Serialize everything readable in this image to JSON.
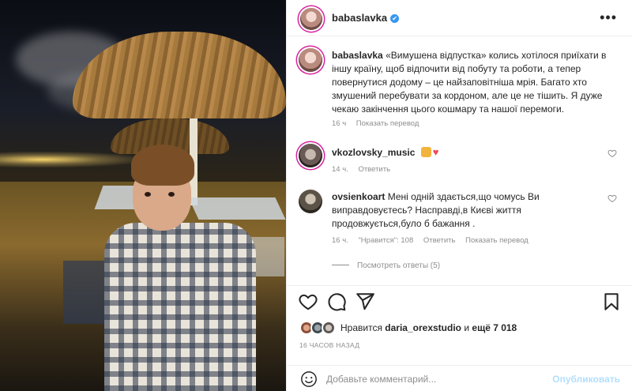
{
  "post_author": {
    "username": "babaslavka",
    "verified_mark": "✔"
  },
  "more_glyph": "•••",
  "caption": {
    "username": "babaslavka",
    "text": "«Вимушена відпустка» колись хотілося приїхати в іншу країну, щоб відпочити від побуту та роботи, а тепер повернутися додому – це найзаповітніша мрія. Багато хто змушений перебувати за кордоном, але це не тішить. Я дуже чекаю закінчення цього кошмару та нашої перемоги.",
    "time": "16 ч",
    "translate": "Показать перевод"
  },
  "comments": [
    {
      "username": "vkozlovsky_music",
      "text": "",
      "heart": "♥",
      "time": "14 ч.",
      "reply": "Ответить",
      "like_icon": "heart-outline-icon"
    },
    {
      "username": "ovsienkoart",
      "text": "Мені одній здається,що чомусь Ви виправдовуєтесь? Насправді,в Києві життя продовжується,було б бажання .",
      "time": "16 ч.",
      "likes": "\"Нравится\": 108",
      "reply": "Ответить",
      "translate": "Показать перевод",
      "view_replies": "Посмотреть ответы (5)",
      "like_icon": "heart-outline-icon"
    }
  ],
  "actions": {
    "like_icon": "heart-outline-icon",
    "comment_icon": "comment-bubble-icon",
    "share_icon": "paper-plane-icon",
    "save_icon": "bookmark-icon"
  },
  "likes": {
    "prefix": "Нравится",
    "user": "daria_orexstudio",
    "middle": "и",
    "rest": "ещё 7 018"
  },
  "time_ago": "16 ЧАСОВ НАЗАД",
  "add_comment": {
    "placeholder": "Добавьте комментарий...",
    "publish": "Опубликовать",
    "emoji_icon": "smiley-icon"
  },
  "colors": {
    "link_blue": "#3897f0",
    "publish_disabled": "#b2dffc",
    "meta_grey": "#8e8e8e",
    "heart_red": "#ed4956"
  }
}
